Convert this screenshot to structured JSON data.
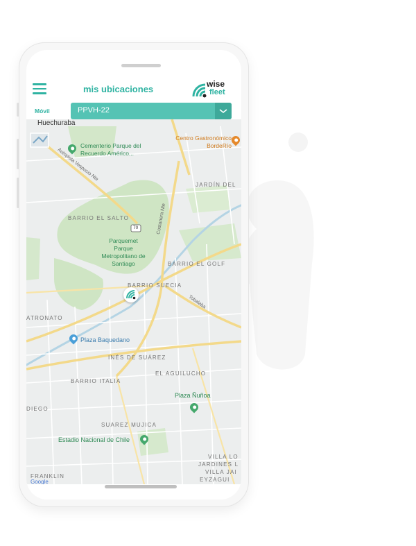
{
  "app": {
    "title": "mis ubicaciones",
    "logo_top": "wise",
    "logo_bottom": "fleet",
    "brand_color": "#2fb3a2"
  },
  "selector": {
    "label": "Móvil",
    "value": "PPVH-22"
  },
  "map": {
    "places": {
      "huechuraba": "Huechuraba",
      "cementerio": "Cementerio Parque del Recuerdo Américo...",
      "centro_gastronomico": "Centro Gastronómico BordeRío",
      "jardin_del": "JARDÍN DEL",
      "barrio_el_salto": "BARRIO EL SALTO",
      "parquemet": "Parquemet Parque Metropolitano de Santiago",
      "barrio_el_golf": "BARRIO EL GOLF",
      "barrio_suecia": "BARRIO SUECIA",
      "atronato": "ATRONATO",
      "plaza_baquedano": "Plaza Baquedano",
      "ines_de_suarez": "INÉS DE SUÁREZ",
      "el_aguilucho": "EL AGUILUCHO",
      "barrio_italia": "BARRIO ITALIA",
      "plaza_nunoa": "Plaza Ñuñoa",
      "diego": "DIEGO",
      "suarez_mujica": "SUAREZ MUJICA",
      "estadio_nacional": "Estadio Nacional de Chile",
      "villa_lo": "VILLA LO",
      "jardines": "JARDINES L",
      "villa_jai": "VILLA JAI",
      "eyzagui": "EYZAGUI",
      "franklin": "FRANKLIN"
    },
    "roads": {
      "autopista": "Autopista Vespucio Nte",
      "costanera": "Costanera Nte",
      "tobalaba": "Tobalaba",
      "route_70": "70"
    },
    "watermark": "Google"
  }
}
